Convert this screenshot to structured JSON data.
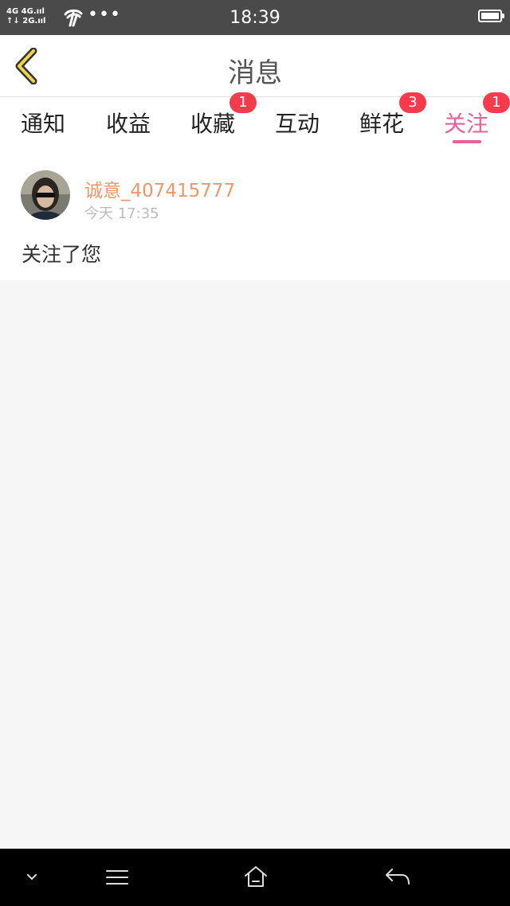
{
  "status_bar": {
    "network_row1": "4G 4G.ııl",
    "network_row2": "↑↓ 2G.ııl",
    "carrier_icon": "china-telecom-icon",
    "more_dots": "•••",
    "time": "18:39",
    "battery_icon": "battery-full-icon"
  },
  "header": {
    "back_icon": "chevron-left-icon",
    "title": "消息",
    "accent_color": "#f0d44a"
  },
  "tabs": [
    {
      "label": "通知",
      "badge": "",
      "active": false
    },
    {
      "label": "收益",
      "badge": "",
      "active": false
    },
    {
      "label": "收藏",
      "badge": "1",
      "active": false
    },
    {
      "label": "互动",
      "badge": "",
      "active": false
    },
    {
      "label": "鲜花",
      "badge": "3",
      "active": false
    },
    {
      "label": "关注",
      "badge": "1",
      "active": true
    }
  ],
  "colors": {
    "active_tab": "#e7609a",
    "badge": "#f53c4c",
    "username": "#ee9868"
  },
  "messages": [
    {
      "avatar_icon": "user-avatar",
      "username": "诚意_407415777",
      "time": "今天 17:35",
      "text": "关注了您"
    }
  ],
  "bottom_nav": {
    "icons": [
      "chevron-down-icon",
      "menu-icon",
      "home-icon",
      "back-arrow-icon"
    ]
  }
}
